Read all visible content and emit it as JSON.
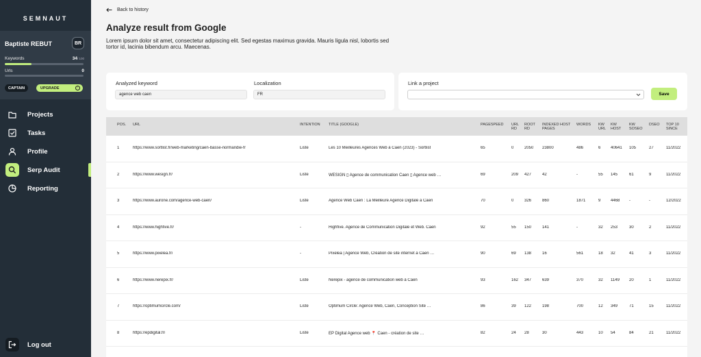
{
  "app": {
    "logo": "SEMNAUT"
  },
  "user": {
    "name": "Baptiste REBUT",
    "initials": "BR",
    "keywords_label": "Keywords",
    "keywords_used": "34",
    "keywords_max": "/ 100",
    "keywords_progress": 0.34,
    "urls_label": "Urls",
    "urls_value": "0",
    "urls_progress": 0,
    "plan": "CAPTAIN",
    "upgrade_label": "UPGRADE"
  },
  "nav": [
    {
      "label": "Projects",
      "icon": "folder-icon",
      "active": false
    },
    {
      "label": "Tasks",
      "icon": "checkbox-icon",
      "active": false
    },
    {
      "label": "Profile",
      "icon": "user-icon",
      "active": false
    },
    {
      "label": "Serp Audit",
      "icon": "search-icon",
      "active": true
    },
    {
      "label": "Reporting",
      "icon": "pie-chart-icon",
      "active": false
    }
  ],
  "logout_label": "Log out",
  "header": {
    "back_label": "Back to history",
    "title": "Analyze result from Google",
    "description": "Lorem ipsum dolor sit amet, consectetur adipiscing elit. Sed egestas maximus gravida. Mauris ligula nisl, lobortis sed tortor id, lacinia bibendum arcu. Maecenas."
  },
  "analysis": {
    "keyword_label": "Analyzed keyword",
    "keyword_value": "agence web caen",
    "localization_label": "Localization",
    "localization_value": "FR"
  },
  "project": {
    "label": "Link a project",
    "selected": "",
    "save_label": "Save"
  },
  "table": {
    "columns": [
      "POS.",
      "URL",
      "INTENTION",
      "TITLE (GOOGLE)",
      "PAGESPEED",
      "URL RD",
      "ROOT RD",
      "INDEXED HOST PAGES",
      "WORDS",
      "KW URL",
      "KW HOST",
      "KW SOSEO",
      "DSEO",
      "TOP 10 SINCE"
    ],
    "rows": [
      [
        "1",
        "https://www.sortlist.fr/web-marketing/caen-basse-normandie-fr",
        "Liste",
        "Les 10 Meilleures Agences Web à Caen (2023) - Sortlist",
        "65",
        "0",
        "2050",
        "23800",
        "486",
        "6",
        "40641",
        "105",
        "27",
        "11/2022"
      ],
      [
        "2",
        "https://www.wesign.fr/",
        "Liste",
        "WESIGN ▯ Agence de communication Caen ▯ Agence web …",
        "69",
        "209",
        "427",
        "42",
        "-",
        "55",
        "145",
        "61",
        "9",
        "11/2022"
      ],
      [
        "3",
        "https://www.aurone.com/agence-web-caen/",
        "Liste",
        "Agence Web Caen : La Meilleure Agence Digitale à Caen",
        "70",
        "0",
        "326",
        "860",
        "1871",
        "9",
        "4468",
        "-",
        "-",
        "12/2022"
      ],
      [
        "4",
        "https://www.highfive.fr/",
        "-",
        "Highfive. Agence de Communication Digitale et Web. Caen",
        "92",
        "55",
        "150",
        "141",
        "-",
        "32",
        "253",
        "30",
        "2",
        "11/2022"
      ],
      [
        "5",
        "https://www.pixelea.fr/",
        "-",
        "Pixelea | Agence Web, Création de site internet à Caen …",
        "90",
        "69",
        "138",
        "16",
        "561",
        "18",
        "32",
        "41",
        "3",
        "11/2022"
      ],
      [
        "6",
        "https://www.nerepix.fr/",
        "Liste",
        "Nerepix - agence de communication web à Caen",
        "93",
        "162",
        "347",
        "639",
        "370",
        "32",
        "1149",
        "20",
        "1",
        "11/2022"
      ],
      [
        "7",
        "https://optimumcircle.com/",
        "Liste",
        "Optimum Circle: Agence Web, Caen, Conception Site …",
        "86",
        "39",
        "122",
        "198",
        "700",
        "12",
        "349",
        "71",
        "15",
        "11/2022"
      ],
      [
        "8",
        "https://epdigital.fr/",
        "Liste",
        "EP Digital Agence web 📍 Caen - création de site …",
        "82",
        "24",
        "28",
        "30",
        "443",
        "10",
        "54",
        "84",
        "21",
        "11/2022"
      ]
    ]
  },
  "colors": {
    "sidebar": "#232e38",
    "accent": "#c2ee7e",
    "background": "#f4f4f4"
  }
}
